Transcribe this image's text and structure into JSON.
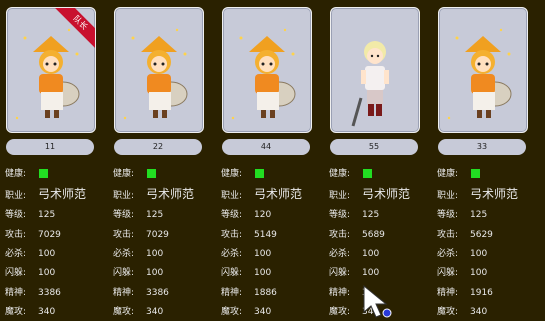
{
  "labels": {
    "health": "健康:",
    "job": "职业:",
    "level": "等级:",
    "attack": "攻击:",
    "crit": "必杀:",
    "dodge": "闪躲:",
    "spirit": "精神:",
    "magic": "魔攻:"
  },
  "leader_badge": "队长",
  "health_color": "#22dd22",
  "characters": [
    {
      "name": "11",
      "job": "弓术师范",
      "level": "125",
      "attack": "7029",
      "crit": "100",
      "dodge": "100",
      "spirit": "3386",
      "magic": "340",
      "sprite": "archer-girl",
      "leader": true
    },
    {
      "name": "22",
      "job": "弓术师范",
      "level": "125",
      "attack": "7029",
      "crit": "100",
      "dodge": "100",
      "spirit": "3386",
      "magic": "340",
      "sprite": "archer-girl",
      "leader": false
    },
    {
      "name": "44",
      "job": "弓术师范",
      "level": "120",
      "attack": "5149",
      "crit": "100",
      "dodge": "100",
      "spirit": "1886",
      "magic": "340",
      "sprite": "archer-girl",
      "leader": false
    },
    {
      "name": "55",
      "job": "弓术师范",
      "level": "125",
      "attack": "5689",
      "crit": "100",
      "dodge": "100",
      "spirit": "3",
      "magic": "340",
      "sprite": "blonde-boy",
      "leader": false
    },
    {
      "name": "33",
      "job": "弓术师范",
      "level": "125",
      "attack": "5629",
      "crit": "100",
      "dodge": "100",
      "spirit": "1916",
      "magic": "340",
      "sprite": "archer-girl",
      "leader": false
    }
  ]
}
